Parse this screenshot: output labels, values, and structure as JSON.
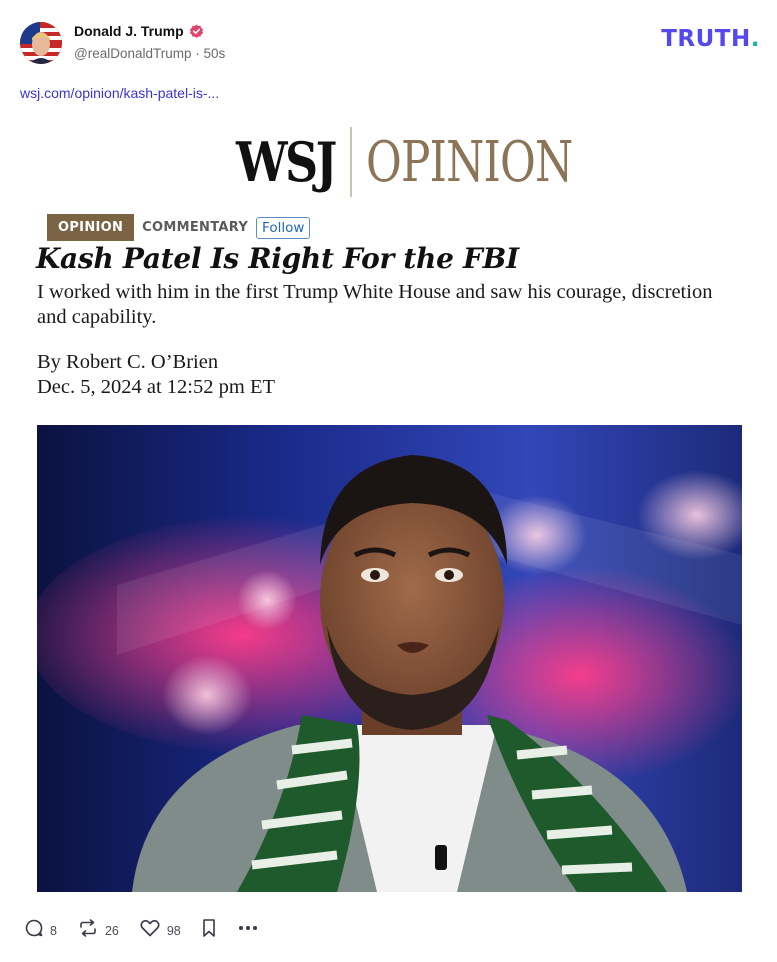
{
  "post": {
    "author_name": "Donald J. Trump",
    "handle": "@realDonaldTrump",
    "separator": "·",
    "time": "50s",
    "link_text": "wsj.com/opinion/kash-patel-is-..."
  },
  "brand": {
    "logo_text": "TRUTH",
    "logo_dot": ".",
    "color": "#5448ee",
    "dot_color": "#17b6a1"
  },
  "article": {
    "masthead_left": "WSJ",
    "masthead_right": "OPINION",
    "tag_primary": "OPINION",
    "tag_secondary": "COMMENTARY",
    "follow_label": "Follow",
    "headline": "Kash Patel Is Right For the FBI",
    "dek": "I worked with him in the first Trump White House and saw his courage, discretion and capability.",
    "byline": "By Robert C. O’Brien",
    "dateline": "Dec. 5, 2024 at 12:52 pm ET",
    "tag_color": "#7b6443",
    "masthead_accent": "#8c7456"
  },
  "actions": {
    "replies": "8",
    "retruths": "26",
    "likes": "98",
    "icons": [
      "comment-icon",
      "retruth-icon",
      "heart-icon",
      "bookmark-icon",
      "more-icon"
    ]
  }
}
